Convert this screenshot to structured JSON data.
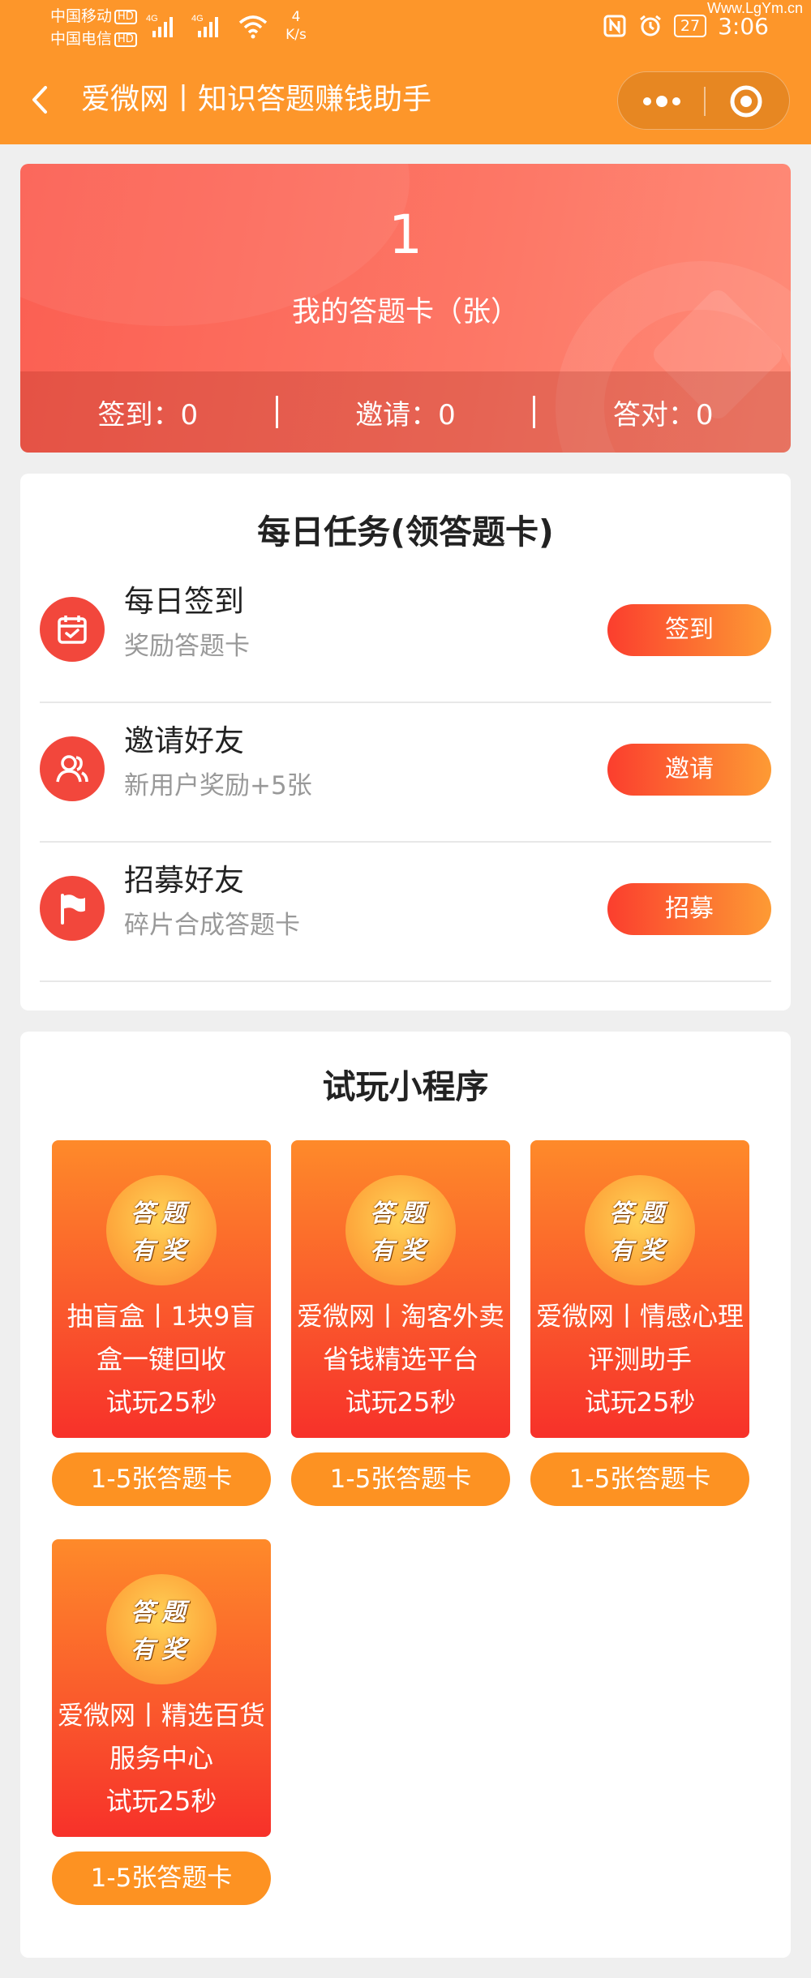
{
  "status_bar": {
    "carrier_1": "中国移动",
    "carrier_2": "中国电信",
    "hd": "HD",
    "signal_1": "4G",
    "signal_2": "4G",
    "speed_value": "4",
    "speed_unit": "K/s",
    "battery": "27",
    "time": "3:06",
    "watermark": "Www.LgYm.cn"
  },
  "header": {
    "title": "爱微网丨知识答题赚钱助手"
  },
  "hero": {
    "count": "1",
    "label": "我的答题卡（张）",
    "stats": [
      {
        "label": "签到：0"
      },
      {
        "label": "邀请：0"
      },
      {
        "label": "答对：0"
      }
    ]
  },
  "daily_tasks": {
    "title": "每日任务(领答题卡)",
    "items": [
      {
        "name": "每日签到",
        "desc": "奖励答题卡",
        "button": "签到",
        "icon": "calendar-icon"
      },
      {
        "name": "邀请好友",
        "desc": "新用户奖励+5张",
        "button": "邀请",
        "icon": "users-icon"
      },
      {
        "name": "招募好友",
        "desc": "碎片合成答题卡",
        "button": "招募",
        "icon": "flag-icon"
      }
    ]
  },
  "trial": {
    "title": "试玩小程序",
    "badge_line_1": "答题",
    "badge_line_2": "有奖",
    "apps": [
      {
        "line1": "抽盲盒丨1块9盲",
        "line2": "盒一键回收",
        "line3": "试玩25秒",
        "button": "1-5张答题卡"
      },
      {
        "line1": "爱微网丨淘客外卖",
        "line2": "省钱精选平台",
        "line3": "试玩25秒",
        "button": "1-5张答题卡"
      },
      {
        "line1": "爱微网丨情感心理",
        "line2": "评测助手",
        "line3": "试玩25秒",
        "button": "1-5张答题卡"
      },
      {
        "line1": "爱微网丨精选百货",
        "line2": "服务中心",
        "line3": "试玩25秒",
        "button": "1-5张答题卡"
      }
    ]
  },
  "colors": {
    "header_bg": "#fd962a",
    "hero_red": "#fb5f52",
    "task_icon_red": "#f2473c",
    "button_gradient_start": "#fb3e2e",
    "button_gradient_end": "#fd9b34",
    "trial_button": "#fd9222"
  }
}
